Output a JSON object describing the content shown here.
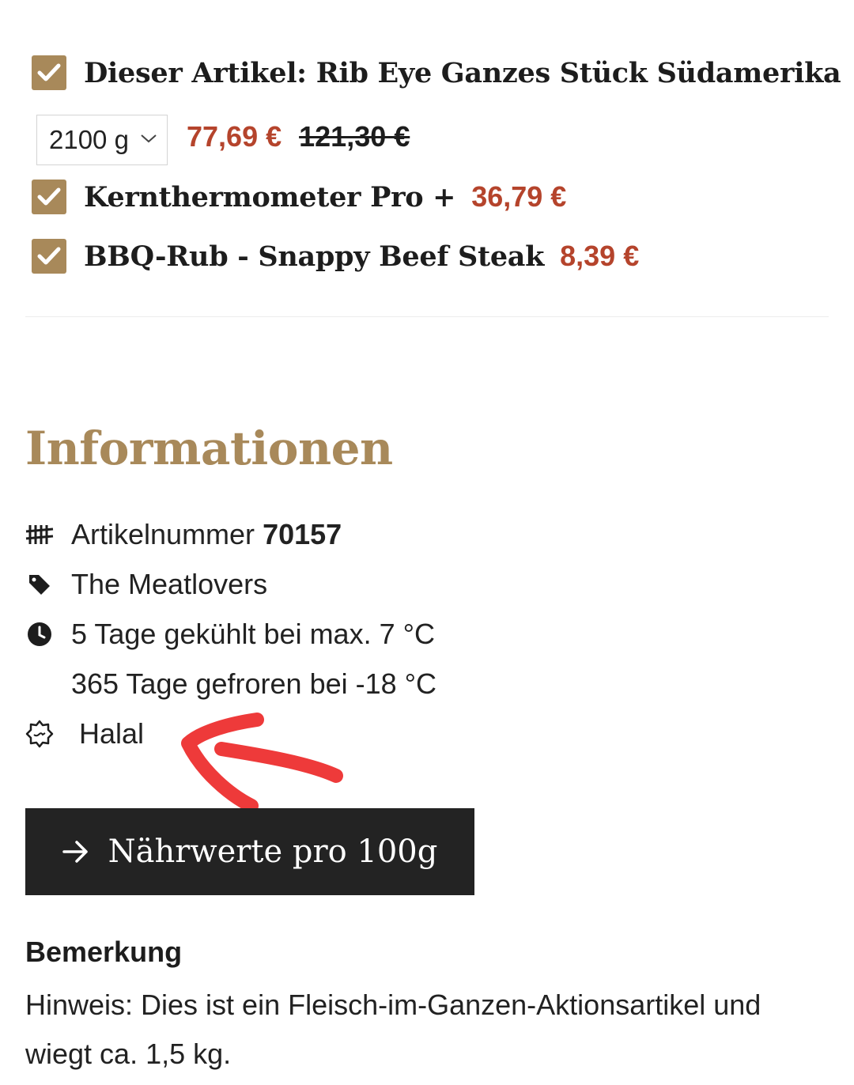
{
  "bundle": {
    "items": [
      {
        "checked": true,
        "name": "Dieser Artikel: Rib Eye Ganzes Stück Südamerika",
        "price": "",
        "old_price": ""
      },
      {
        "checked": true,
        "name": "Kernthermometer Pro +",
        "price": "36,79 €"
      },
      {
        "checked": true,
        "name": "BBQ-Rub - Snappy Beef Steak",
        "price": "8,39 €"
      }
    ],
    "variant_select": {
      "value": "2100 g"
    },
    "main_price": "77,69 €",
    "main_old_price": "121,30 €"
  },
  "info": {
    "title": "Informationen",
    "article_label": "Artikelnummer",
    "article_number": "70157",
    "brand": "The Meatlovers",
    "storage_chilled": "5 Tage gekühlt bei max. 7 °C",
    "storage_frozen": "365 Tage gefroren bei -18 °C",
    "halal": "Halal"
  },
  "nutrition_button": "Nährwerte pro 100g",
  "remark": {
    "heading": "Bemerkung",
    "text": "Hinweis: Dies ist ein Fleisch-im-Ganzen-Aktionsartikel und wiegt ca. 1,5 kg."
  },
  "colors": {
    "accent": "#a8895a",
    "price": "#b5442c",
    "button": "#232323",
    "annotation": "#ee3a3a"
  }
}
